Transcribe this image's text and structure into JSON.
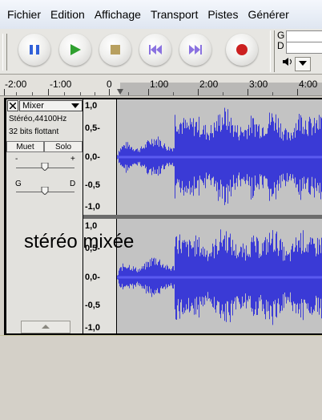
{
  "menu": [
    "Fichier",
    "Edition",
    "Affichage",
    "Transport",
    "Pistes",
    "Générer"
  ],
  "toolbar": {
    "buttons": [
      {
        "name": "pause-button",
        "icon": "pause-icon",
        "color": "#3060d8"
      },
      {
        "name": "play-button",
        "icon": "play-icon",
        "color": "#2fa02f"
      },
      {
        "name": "stop-button",
        "icon": "stop-icon",
        "color": "#b8a060"
      },
      {
        "name": "skip-start-button",
        "icon": "skip-start-icon",
        "color": "#8a72e0"
      },
      {
        "name": "skip-end-button",
        "icon": "skip-end-icon",
        "color": "#8a72e0"
      },
      {
        "name": "record-button",
        "icon": "record-icon",
        "color": "#cc2020"
      }
    ],
    "meter_left": "G",
    "meter_right": "D",
    "volume_icon": "speaker-icon"
  },
  "ruler": {
    "labels": [
      "-2:00",
      "-1:00",
      "0",
      "1:00",
      "2:00",
      "3:00",
      "4:00"
    ]
  },
  "track": {
    "name": "Mixer",
    "info_line1": "Stéréo,44100Hz",
    "info_line2": "32 bits flottant",
    "mute": "Muet",
    "solo": "Solo",
    "gain_minus": "-",
    "gain_plus": "+",
    "pan_left": "G",
    "pan_right": "D",
    "scale_labels": [
      "1,0",
      "0,5-",
      "0,0-",
      "-0,5",
      "-1,0"
    ]
  },
  "overlay_text": "stéréo mixée",
  "colors": {
    "wave": "#3a3ad6",
    "wave_bg": "#c3c3c3"
  }
}
